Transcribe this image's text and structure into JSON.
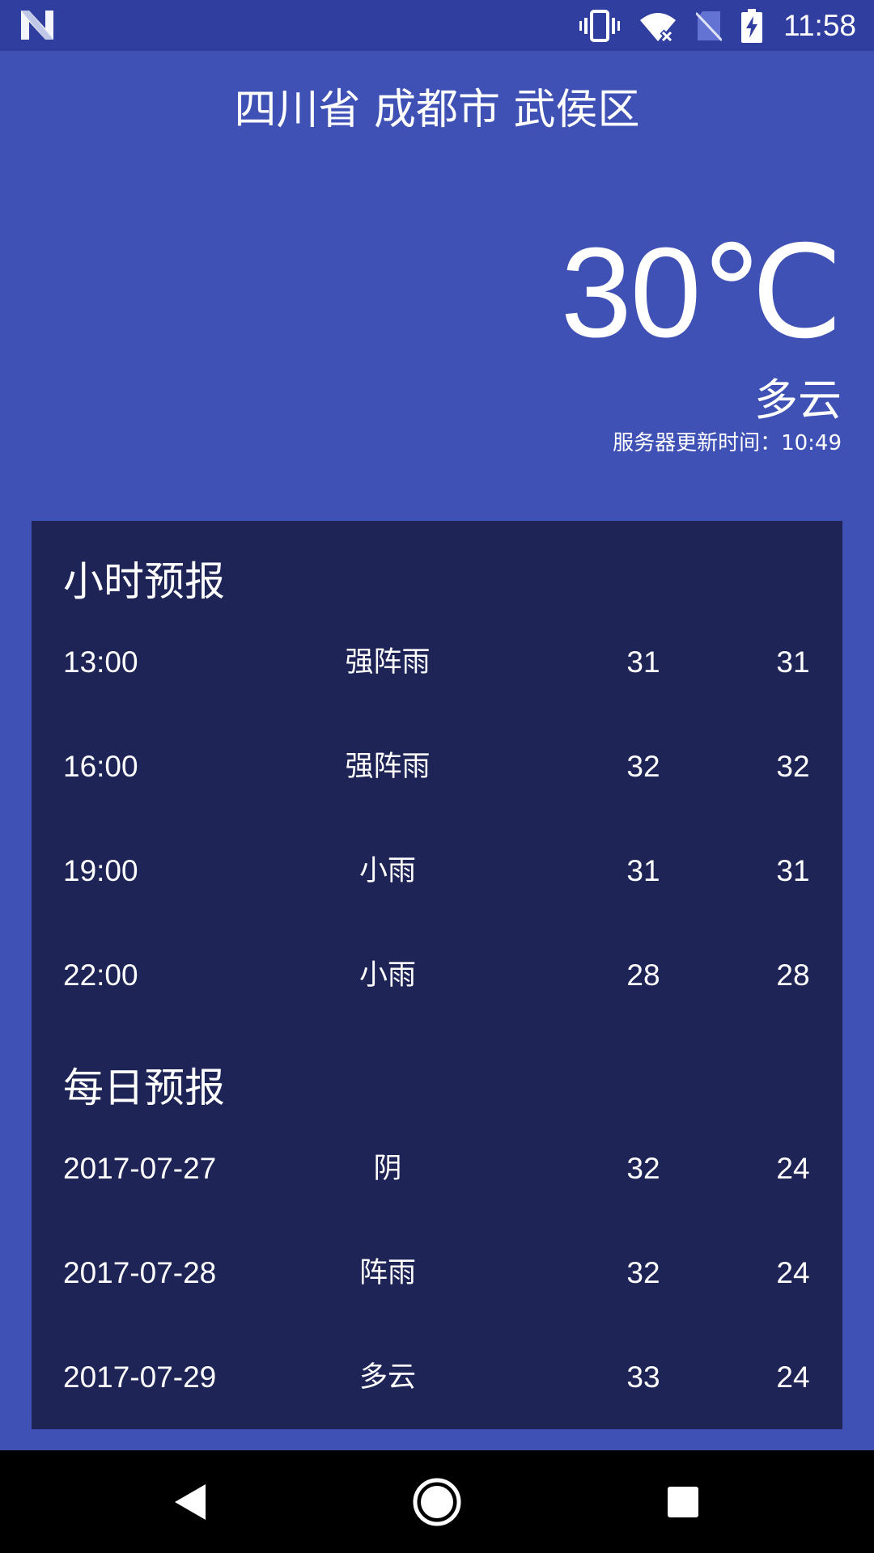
{
  "status_bar": {
    "time": "11:58",
    "icons": [
      "n-logo-icon",
      "vibrate-icon",
      "wifi-off-icon",
      "no-sim-icon",
      "battery-charging-icon"
    ]
  },
  "header": {
    "location": "四川省 成都市 武侯区",
    "temperature": "30℃",
    "condition": "多云",
    "update_time": "服务器更新时间：10:49"
  },
  "hourly": {
    "title": "小时预报",
    "rows": [
      {
        "time": "13:00",
        "condition": "强阵雨",
        "high": "31",
        "low": "31"
      },
      {
        "time": "16:00",
        "condition": "强阵雨",
        "high": "32",
        "low": "32"
      },
      {
        "time": "19:00",
        "condition": "小雨",
        "high": "31",
        "low": "31"
      },
      {
        "time": "22:00",
        "condition": "小雨",
        "high": "28",
        "low": "28"
      }
    ]
  },
  "daily": {
    "title": "每日预报",
    "rows": [
      {
        "date": "2017-07-27",
        "condition": "阴",
        "high": "32",
        "low": "24"
      },
      {
        "date": "2017-07-28",
        "condition": "阵雨",
        "high": "32",
        "low": "24"
      },
      {
        "date": "2017-07-29",
        "condition": "多云",
        "high": "33",
        "low": "24"
      }
    ]
  },
  "nav_bar": {
    "buttons": [
      "back-icon",
      "home-icon",
      "recents-icon"
    ]
  },
  "colors": {
    "background": "#3F51B5",
    "status_bar": "#303F9F",
    "card": "#1E2456",
    "text": "#FFFFFF"
  }
}
